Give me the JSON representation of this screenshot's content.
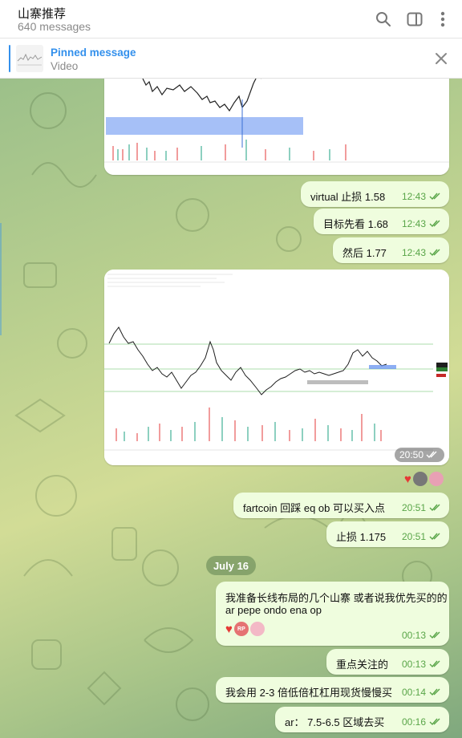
{
  "header": {
    "title": "山寨推荐",
    "subtitle": "640 messages"
  },
  "pinned": {
    "title": "Pinned message",
    "subtitle": "Video"
  },
  "date_separator": "July 16",
  "messages": [
    {
      "text": "virtual 止损 1.58",
      "time": "12:43"
    },
    {
      "text": "目标先看 1.68",
      "time": "12:43"
    },
    {
      "text": "然后 1.77",
      "time": "12:43"
    },
    {
      "time": "20:50"
    },
    {
      "text": "fartcoin 回踩 eq ob 可以买入点",
      "time": "20:51"
    },
    {
      "text": "止损 1.175",
      "time": "20:51"
    },
    {
      "text_line1": "我准备长线布局的几个山寨  或者说我优先买的的",
      "text_line2": "ar pepe  ondo  ena op",
      "time": "00:13",
      "reaction_avatar": "RP"
    },
    {
      "text": "重点关注的",
      "time": "00:13"
    },
    {
      "text": "我会用 2-3 倍低倍杠杠用现货慢慢买",
      "time": "00:14"
    },
    {
      "text": "ar：  7.5-6.5 区域去买",
      "time": "00:16"
    }
  ],
  "colors": {
    "accent": "#3390ec",
    "bubble_out": "#effdde",
    "meta_green": "#59a548",
    "heart": "#e53935"
  },
  "icons": [
    "search-icon",
    "sidebar-toggle-icon",
    "more-vert-icon",
    "close-icon",
    "double-check-icon",
    "heart-reaction-icon"
  ]
}
